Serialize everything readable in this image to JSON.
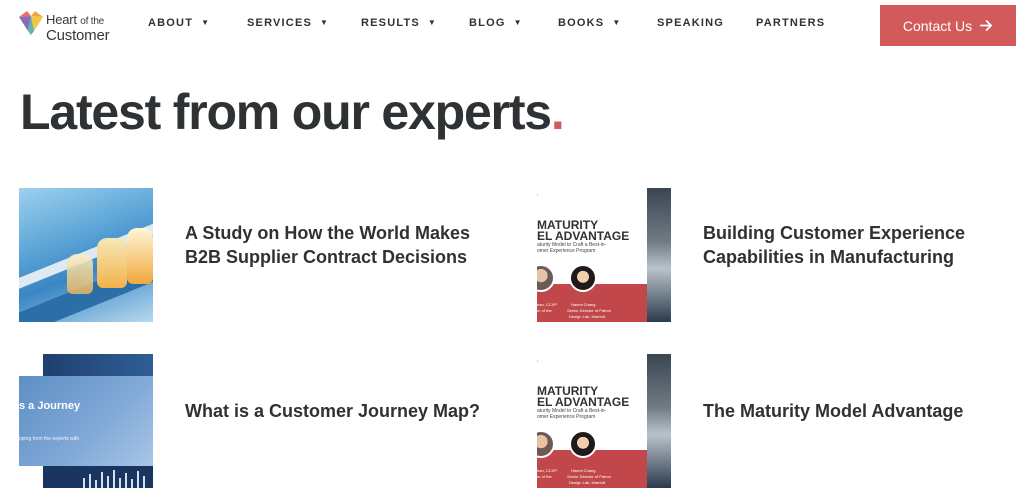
{
  "brand": {
    "name_line1": "Heart",
    "name_of": "of the",
    "name_line2": "Customer"
  },
  "nav": [
    {
      "label": "ABOUT",
      "dropdown": true
    },
    {
      "label": "SERVICES",
      "dropdown": true
    },
    {
      "label": "RESULTS",
      "dropdown": true
    },
    {
      "label": "BLOG",
      "dropdown": true
    },
    {
      "label": "BOOKS",
      "dropdown": true
    },
    {
      "label": "SPEAKING",
      "dropdown": false
    },
    {
      "label": "PARTNERS",
      "dropdown": false
    }
  ],
  "cta": {
    "label": "Contact Us",
    "icon": "arrow-right-icon"
  },
  "page": {
    "title": "Latest from our experts",
    "title_dot": "."
  },
  "articles": [
    {
      "title": "A Study on How the World Makes B2B Supplier Contract Decisions",
      "thumb": "factory"
    },
    {
      "title": "Building Customer Experience Capabilities in Manufacturing",
      "thumb": "maturity"
    },
    {
      "title": "What is a Customer Journey Map?",
      "thumb": "journey"
    },
    {
      "title": "The Maturity Model Advantage",
      "thumb": "maturity"
    }
  ],
  "thumb_text": {
    "maturity": {
      "line1": "MATURITY",
      "line2": "EL ADVANTAGE",
      "sub1": "aturity Model to Craft a Best-in-",
      "sub2": "omer Experience Program",
      "person1": "ban, CCXP",
      "person1_role": "er of the",
      "person2": "Hanmi Chang",
      "person2_role": "Senior Director of Patron",
      "person2_org": "Design Lab, Marriott"
    },
    "journey": {
      "title": "s a Journey",
      "subtitle": "pping from the experts with"
    }
  },
  "colors": {
    "accent": "#d25a5a",
    "text": "#2f3234"
  }
}
